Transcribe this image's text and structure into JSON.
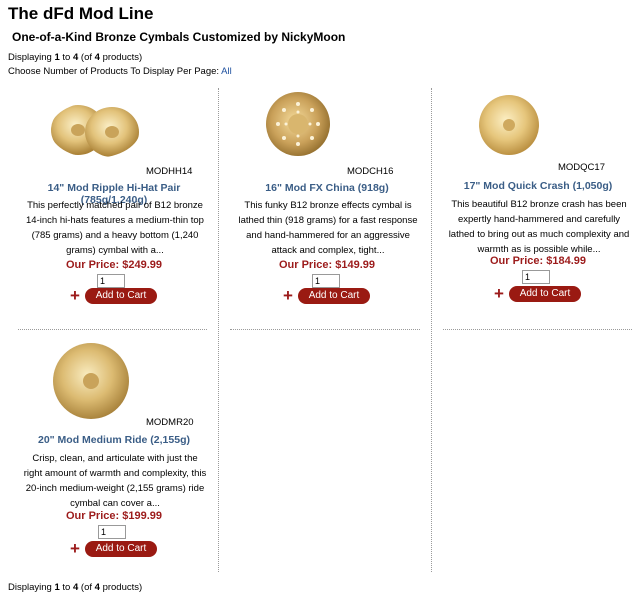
{
  "header": {
    "title": "The dFd Mod Line",
    "subtitle": "One-of-a-Kind Bronze Cymbals Customized by NickyMoon"
  },
  "listing": {
    "display_prefix": "Displaying ",
    "display_from": "1",
    "display_to_word": " to ",
    "display_to": "4",
    "display_of_open": " (of ",
    "display_total": "4",
    "display_suffix": " products)",
    "per_page_label": "Choose Number of Products To Display Per Page: ",
    "per_page_option": "All"
  },
  "products": [
    {
      "model": "MODHH14",
      "name": "14\" Mod Ripple Hi-Hat Pair (785g/1,240g)",
      "description": "This perfectly matched pair of B12 bronze 14-inch hi-hats features a medium-thin top (785 grams) and a heavy bottom (1,240 grams) cymbal with a...",
      "price": "Our Price: $249.99",
      "qty": "1",
      "plus": "+",
      "cart_label": "Add to Cart",
      "image_icon": "hi-hat-cymbal-pair-image"
    },
    {
      "model": "MODCH16",
      "name": "16\" Mod FX China (918g)",
      "description": "This funky B12 bronze effects cymbal is lathed thin (918 grams) for a fast response and hand-hammered for an aggressive attack and complex, tight...",
      "price": "Our Price: $149.99",
      "qty": "1",
      "plus": "+",
      "cart_label": "Add to Cart",
      "image_icon": "fx-china-cymbal-image"
    },
    {
      "model": "MODQC17",
      "name": "17\" Mod Quick Crash (1,050g)",
      "description": "This beautiful B12 bronze crash has been expertly hand-hammered and carefully lathed to bring out as much complexity and warmth as is possible while...",
      "price": "Our Price: $184.99",
      "qty": "1",
      "plus": "+",
      "cart_label": "Add to Cart",
      "image_icon": "crash-cymbal-image"
    },
    {
      "model": "MODMR20",
      "name": "20\" Mod Medium Ride (2,155g)",
      "description": "Crisp, clean, and articulate with just the right amount of warmth and complexity, this 20-inch medium-weight (2,155 grams) ride cymbal can cover a...",
      "price": "Our Price: $199.99",
      "qty": "1",
      "plus": "+",
      "cart_label": "Add to Cart",
      "image_icon": "ride-cymbal-image"
    }
  ],
  "colors": {
    "link_blue": "#3a5d86",
    "price_red": "#9c1b1b",
    "button_red": "#9a1a12",
    "bronze_light": "#f3dc9a",
    "bronze_dark": "#b58a3c"
  }
}
